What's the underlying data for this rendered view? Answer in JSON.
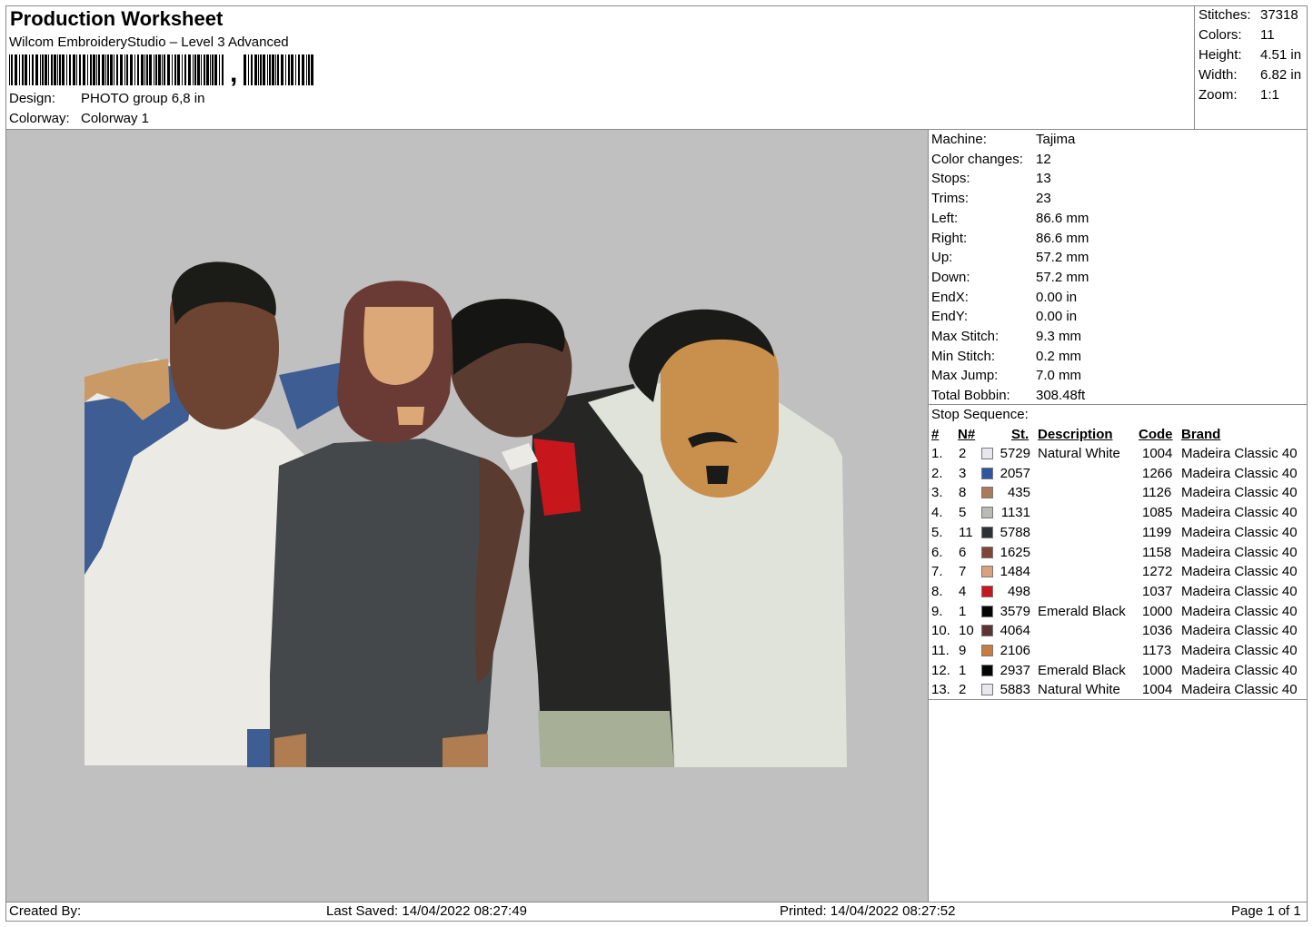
{
  "header": {
    "title": "Production Worksheet",
    "software": "Wilcom EmbroideryStudio – Level 3 Advanced",
    "barcode_suffix": ",",
    "design_label": "Design:",
    "design_value": "PHOTO group 6,8 in",
    "colorway_label": "Colorway:",
    "colorway_value": "Colorway 1"
  },
  "summary": [
    {
      "label": "Stitches:",
      "value": "37318"
    },
    {
      "label": "Colors:",
      "value": "11"
    },
    {
      "label": "Height:",
      "value": "4.51 in"
    },
    {
      "label": "Width:",
      "value": "6.82 in"
    },
    {
      "label": "Zoom:",
      "value": "1:1"
    }
  ],
  "machine_info": [
    {
      "label": "Machine:",
      "value": "Tajima"
    },
    {
      "label": "Color changes:",
      "value": "12"
    },
    {
      "label": "Stops:",
      "value": "13"
    },
    {
      "label": "Trims:",
      "value": "23"
    },
    {
      "label": "Left:",
      "value": "86.6 mm"
    },
    {
      "label": "Right:",
      "value": "86.6 mm"
    },
    {
      "label": "Up:",
      "value": "57.2 mm"
    },
    {
      "label": "Down:",
      "value": "57.2 mm"
    },
    {
      "label": "EndX:",
      "value": "0.00 in"
    },
    {
      "label": "EndY:",
      "value": "0.00 in"
    },
    {
      "label": "Max Stitch:",
      "value": "9.3 mm"
    },
    {
      "label": "Min Stitch:",
      "value": "0.2 mm"
    },
    {
      "label": "Max Jump:",
      "value": "7.0 mm"
    },
    {
      "label": "Total Bobbin:",
      "value": "308.48ft"
    }
  ],
  "stop_sequence": {
    "title": "Stop Sequence:",
    "headers": {
      "num": "#",
      "needle": "N#",
      "st": "St.",
      "desc": "Description",
      "code": "Code",
      "brand": "Brand"
    },
    "rows": [
      {
        "num": "1.",
        "needle": "2",
        "color": "#e8e8ec",
        "st": "5729",
        "desc": "Natural White",
        "code": "1004",
        "brand": "Madeira Classic 40"
      },
      {
        "num": "2.",
        "needle": "3",
        "color": "#2f56a3",
        "st": "2057",
        "desc": "",
        "code": "1266",
        "brand": "Madeira Classic 40"
      },
      {
        "num": "3.",
        "needle": "8",
        "color": "#a97b5c",
        "st": "435",
        "desc": "",
        "code": "1126",
        "brand": "Madeira Classic 40"
      },
      {
        "num": "4.",
        "needle": "5",
        "color": "#b9bab3",
        "st": "1131",
        "desc": "",
        "code": "1085",
        "brand": "Madeira Classic 40"
      },
      {
        "num": "5.",
        "needle": "11",
        "color": "#2e3236",
        "st": "5788",
        "desc": "",
        "code": "1199",
        "brand": "Madeira Classic 40"
      },
      {
        "num": "6.",
        "needle": "6",
        "color": "#7e4636",
        "st": "1625",
        "desc": "",
        "code": "1158",
        "brand": "Madeira Classic 40"
      },
      {
        "num": "7.",
        "needle": "7",
        "color": "#d9a27c",
        "st": "1484",
        "desc": "",
        "code": "1272",
        "brand": "Madeira Classic 40"
      },
      {
        "num": "8.",
        "needle": "4",
        "color": "#c8161d",
        "st": "498",
        "desc": "",
        "code": "1037",
        "brand": "Madeira Classic 40"
      },
      {
        "num": "9.",
        "needle": "1",
        "color": "#050505",
        "st": "3579",
        "desc": "Emerald Black",
        "code": "1000",
        "brand": "Madeira Classic 40"
      },
      {
        "num": "10.",
        "needle": "10",
        "color": "#5c3431",
        "st": "4064",
        "desc": "",
        "code": "1036",
        "brand": "Madeira Classic 40"
      },
      {
        "num": "11.",
        "needle": "9",
        "color": "#c97c3f",
        "st": "2106",
        "desc": "",
        "code": "1173",
        "brand": "Madeira Classic 40"
      },
      {
        "num": "12.",
        "needle": "1",
        "color": "#050505",
        "st": "2937",
        "desc": "Emerald Black",
        "code": "1000",
        "brand": "Madeira Classic 40"
      },
      {
        "num": "13.",
        "needle": "2",
        "color": "#e8e8ec",
        "st": "5883",
        "desc": "Natural White",
        "code": "1004",
        "brand": "Madeira Classic 40"
      }
    ]
  },
  "footer": {
    "created_by": "Created By:",
    "last_saved": "Last Saved: 14/04/2022 08:27:49",
    "printed": "Printed: 14/04/2022 08:27:52",
    "page": "Page 1 of 1"
  }
}
